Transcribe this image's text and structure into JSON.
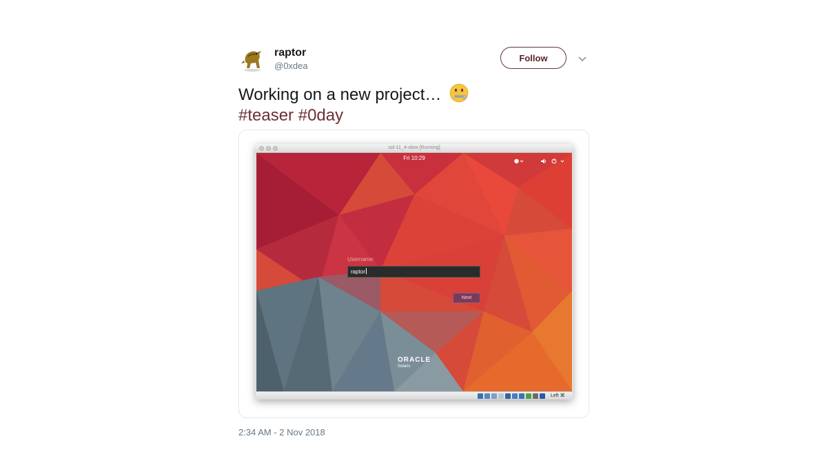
{
  "author": {
    "name": "raptor",
    "handle": "@0xdea"
  },
  "follow_label": "Follow",
  "tweet": {
    "text": "Working on a new project…",
    "hashtags": [
      "#teaser",
      "#0day"
    ]
  },
  "vm": {
    "window_title": "sol-11_4-vbox [Running]",
    "clock": "Fri 10:29",
    "login_label": "Username:",
    "username_value": "raptor",
    "next_label": "Next",
    "brand": "ORACLE",
    "product": "Solaris",
    "host_key": "Left ⌘"
  },
  "timestamp": "2:34 AM - 2 Nov 2018",
  "colors": {
    "accent": "#6b2f36",
    "handle": "#657786"
  }
}
